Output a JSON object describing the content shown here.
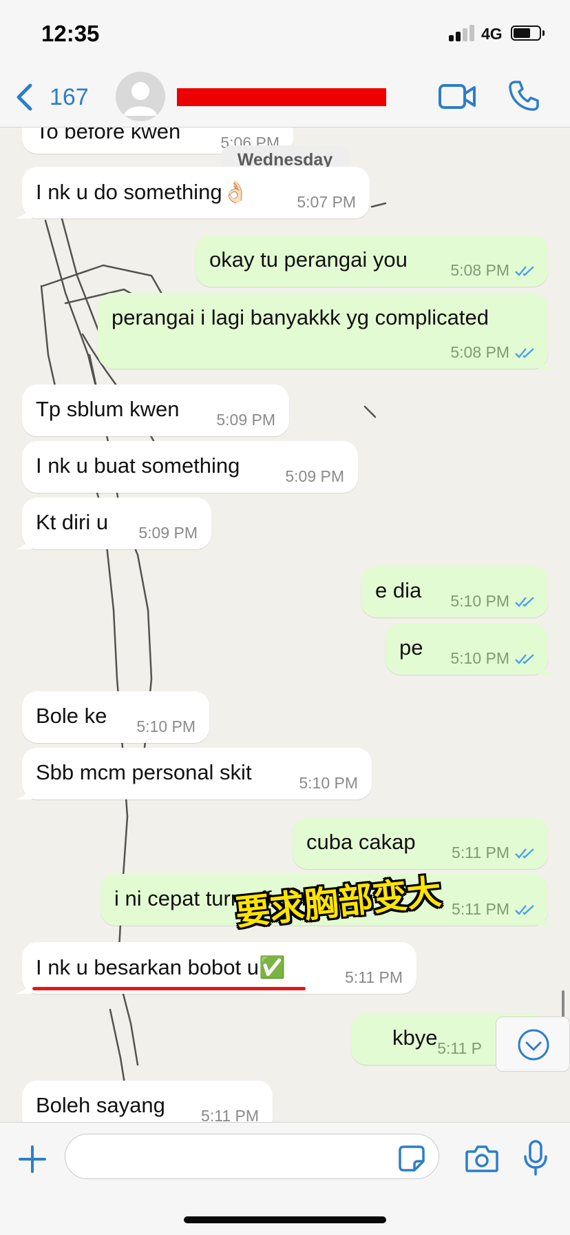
{
  "status_bar": {
    "time": "12:35",
    "network": "4G",
    "battery_level": 0.68
  },
  "header": {
    "back_count": "167"
  },
  "chat": {
    "day_separator": "Wednesday",
    "messages": [
      {
        "direction": "in",
        "text": "To before kwen",
        "time": "5:06 PM"
      },
      {
        "direction": "in",
        "text": "I nk u do something👌🏻",
        "time": "5:07 PM"
      },
      {
        "direction": "out",
        "text": "okay tu perangai you",
        "time": "5:08 PM",
        "read": true
      },
      {
        "direction": "out",
        "text": "perangai i lagi banyakkk yg complicated",
        "time": "5:08 PM",
        "read": true
      },
      {
        "direction": "in",
        "text": "Tp sblum kwen",
        "time": "5:09 PM"
      },
      {
        "direction": "in",
        "text": "I nk u buat something",
        "time": "5:09 PM"
      },
      {
        "direction": "in",
        "text": "Kt diri u",
        "time": "5:09 PM"
      },
      {
        "direction": "out",
        "text": "e dia",
        "time": "5:10 PM",
        "read": true
      },
      {
        "direction": "out",
        "text": "pe",
        "time": "5:10 PM",
        "read": true
      },
      {
        "direction": "in",
        "text": "Bole ke",
        "time": "5:10 PM"
      },
      {
        "direction": "in",
        "text": "Sbb mcm personal skit",
        "time": "5:10 PM"
      },
      {
        "direction": "out",
        "text": "cuba cakap",
        "time": "5:11 PM",
        "read": true
      },
      {
        "direction": "out",
        "text": "i ni cepat turn off dgn orang",
        "time": "5:11 PM",
        "read": true
      },
      {
        "direction": "in",
        "text": "I nk u besarkan bobot u✅",
        "time": "5:11 PM"
      },
      {
        "direction": "out",
        "text": "kbye",
        "time": "5:11 P"
      },
      {
        "direction": "in",
        "text": "Boleh sayang",
        "time": "5:11 PM"
      }
    ],
    "overlay_caption": "要求胸部变大"
  },
  "colors": {
    "accent": "#2c7ec9",
    "incoming_bubble": "#ffffff",
    "outgoing_bubble": "#e3fbd2",
    "read_ticks": "#4fa3e8",
    "redaction": "#ee0000",
    "caption": "#ffe400"
  },
  "icons": {
    "back": "chevron-left-icon",
    "video": "video-camera-icon",
    "call": "phone-icon",
    "add": "plus-icon",
    "sticker": "sticker-icon",
    "camera": "camera-icon",
    "mic": "microphone-icon",
    "scroll_down": "chevron-down-circle-icon"
  }
}
